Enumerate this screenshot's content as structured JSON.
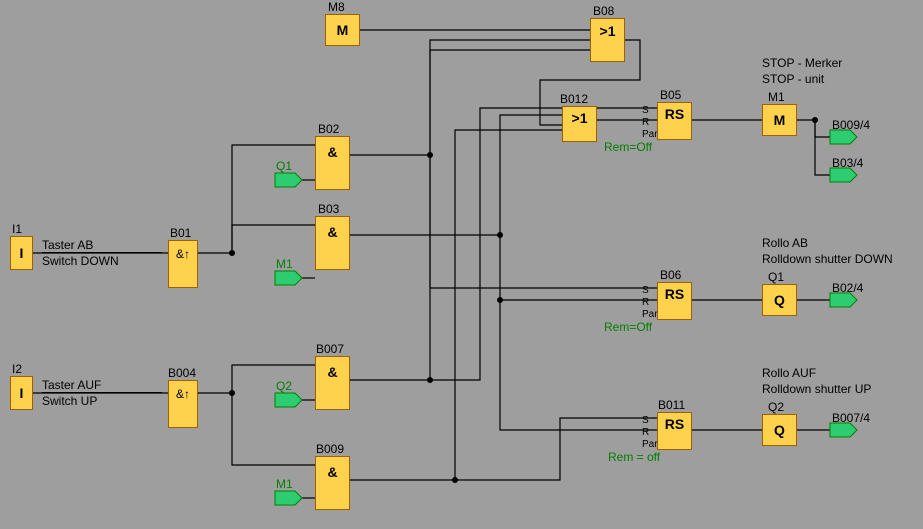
{
  "blocks": {
    "M8": {
      "name": "M8",
      "sym": "M"
    },
    "B08": {
      "name": "B08",
      "sym": ">1"
    },
    "B012": {
      "name": "B012",
      "sym": ">1",
      "rem": "Rem=Off"
    },
    "B05": {
      "name": "B05",
      "sym": "RS"
    },
    "M1": {
      "name": "M1",
      "sym": "M"
    },
    "B02": {
      "name": "B02",
      "sym": "&"
    },
    "B03": {
      "name": "B03",
      "sym": "&"
    },
    "I1": {
      "name": "I1",
      "sym": "I"
    },
    "B01": {
      "name": "B01",
      "sym": "&↑"
    },
    "I2": {
      "name": "I2",
      "sym": "I"
    },
    "B004": {
      "name": "B004",
      "sym": "&↑"
    },
    "B007": {
      "name": "B007",
      "sym": "&"
    },
    "B009": {
      "name": "B009",
      "sym": "&"
    },
    "B06": {
      "name": "B06",
      "sym": "RS",
      "rem": "Rem=Off"
    },
    "Q1": {
      "name": "Q1",
      "sym": "Q"
    },
    "B011": {
      "name": "B011",
      "sym": "RS",
      "rem": "Rem = off"
    },
    "Q2": {
      "name": "Q2",
      "sym": "Q"
    }
  },
  "inlabels": {
    "Q1c": "Q1",
    "M1c1": "M1",
    "Q2c": "Q2",
    "M1c2": "M1"
  },
  "outlabels": {
    "o1": "B009/4",
    "o2": "B03/4",
    "o3": "B02/4",
    "o4": "B007/4"
  },
  "text": {
    "tasterAB1": "Taster AB",
    "tasterAB2": "Switch DOWN",
    "tasterAUF1": "Taster AUF",
    "tasterAUF2": "Switch UP",
    "stop1": "STOP  - Merker",
    "stop2": "STOP - unit",
    "rolloAB1": "Rollo AB",
    "rolloAB2": "Rolldown shutter DOWN",
    "rolloAUF1": "Rollo AUF",
    "rolloAUF2": "Rolldown shutter UP",
    "parS": "S",
    "parR": "R",
    "parPar": "Par"
  }
}
